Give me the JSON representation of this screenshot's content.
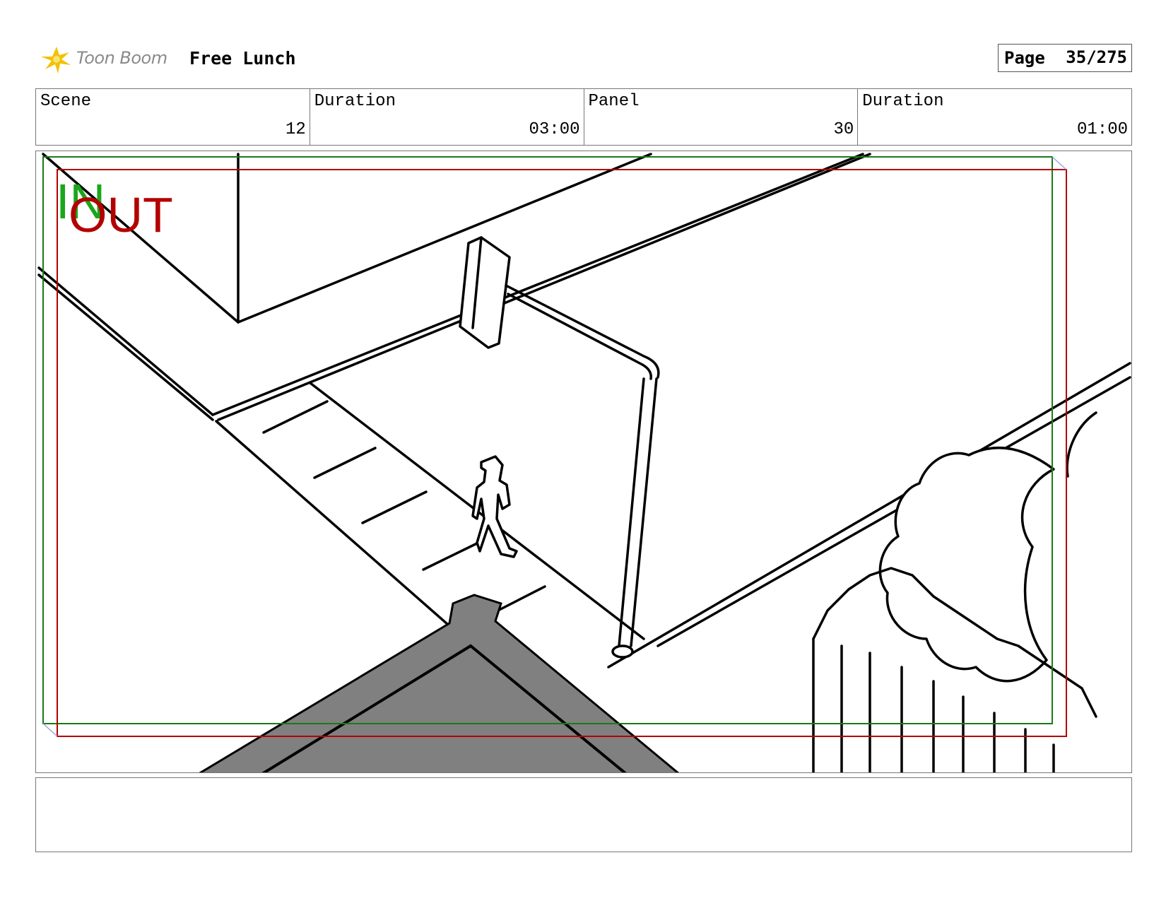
{
  "header": {
    "logo_text": "Toon Boom",
    "project_title": "Free Lunch",
    "page_label": "Page",
    "page_value": "35/275"
  },
  "info": {
    "scene_label": "Scene",
    "scene_value": "12",
    "scene_duration_label": "Duration",
    "scene_duration_value": "03:00",
    "panel_label": "Panel",
    "panel_value": "30",
    "panel_duration_label": "Duration",
    "panel_duration_value": "01:00"
  },
  "panel": {
    "in_label": "IN",
    "out_label": "OUT",
    "in_color": "#1aa61a",
    "out_color": "#b30000",
    "roof_fill": "#808080"
  },
  "notes": {
    "text": ""
  },
  "icons": [
    "toon-boom-logo-icon"
  ]
}
